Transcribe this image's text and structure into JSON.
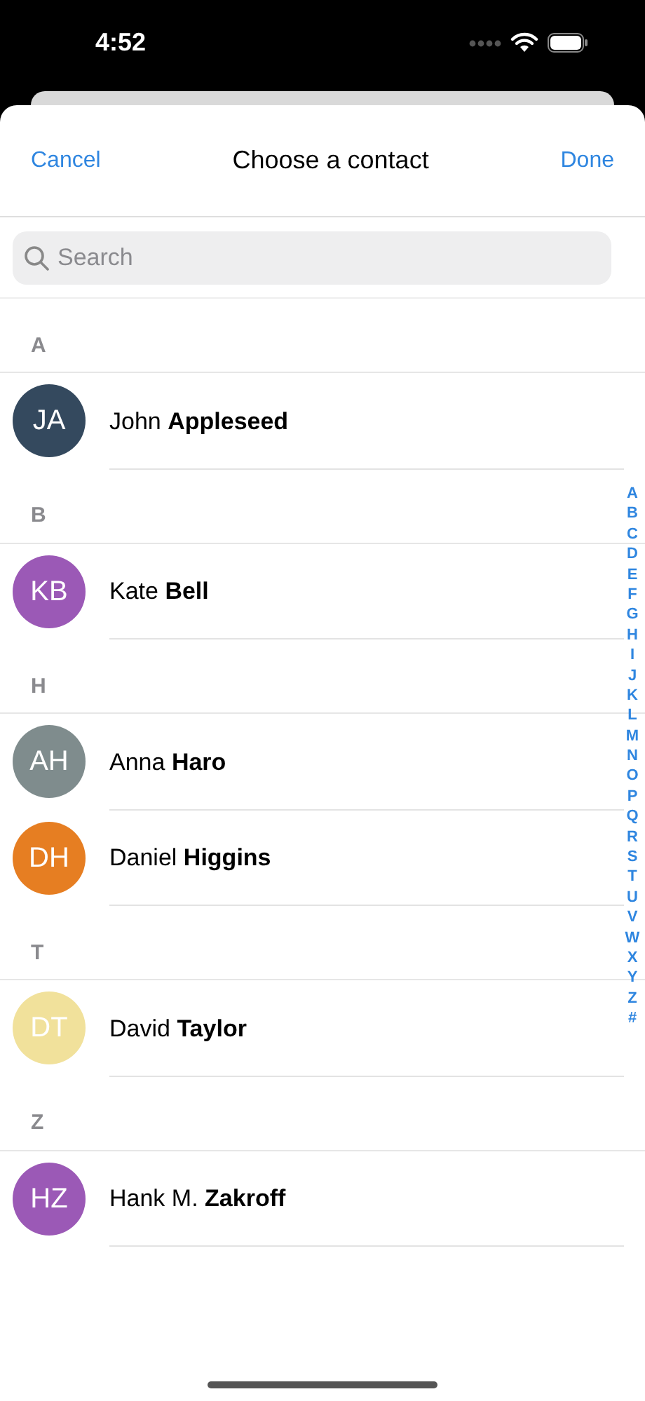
{
  "status_bar": {
    "time": "4:52"
  },
  "nav": {
    "cancel": "Cancel",
    "title": "Choose a contact",
    "done": "Done"
  },
  "search": {
    "placeholder": "Search"
  },
  "sections": [
    {
      "letter": "A",
      "contacts": [
        {
          "initials": "JA",
          "name": "John **Appleseed**",
          "color": "#34495e"
        }
      ]
    },
    {
      "letter": "B",
      "contacts": [
        {
          "initials": "KB",
          "name": "Kate **Bell**",
          "color": "#9b59b6"
        }
      ]
    },
    {
      "letter": "H",
      "contacts": [
        {
          "initials": "AH",
          "name": "Anna **Haro**",
          "color": "#7f8c8d"
        },
        {
          "initials": "DH",
          "name": "Daniel **Higgins**",
          "color": "#e67e22"
        }
      ]
    },
    {
      "letter": "T",
      "contacts": [
        {
          "initials": "DT",
          "name": "David **Taylor**",
          "color": "#f1e19b"
        }
      ]
    },
    {
      "letter": "Z",
      "contacts": [
        {
          "initials": "HZ",
          "name": "Hank M. **Zakroff**",
          "color": "#9b59b6"
        }
      ]
    }
  ],
  "index": [
    "A",
    "B",
    "C",
    "D",
    "E",
    "F",
    "G",
    "H",
    "I",
    "J",
    "K",
    "L",
    "M",
    "N",
    "O",
    "P",
    "Q",
    "R",
    "S",
    "T",
    "U",
    "V",
    "W",
    "X",
    "Y",
    "Z",
    "#"
  ]
}
